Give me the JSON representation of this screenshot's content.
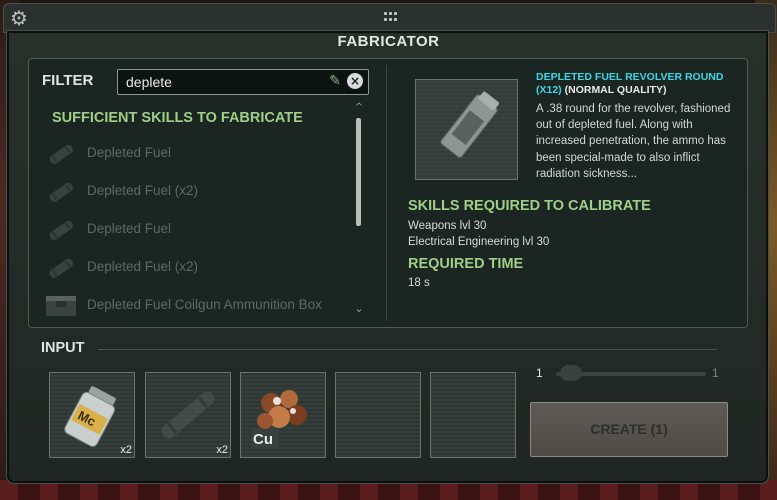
{
  "window": {
    "title": "FABRICATOR"
  },
  "filter": {
    "label": "FILTER",
    "value": "deplete"
  },
  "recipes": {
    "section_title": "SUFFICIENT SKILLS TO FABRICATE",
    "items": [
      {
        "label": "Depleted Fuel",
        "icon": "fuel-rod-icon"
      },
      {
        "label": "Depleted Fuel (x2)",
        "icon": "fuel-rod-icon"
      },
      {
        "label": "Depleted Fuel",
        "icon": "fuel-rod-icon"
      },
      {
        "label": "Depleted Fuel (x2)",
        "icon": "fuel-rod-icon"
      },
      {
        "label": "Depleted Fuel Coilgun Ammunition Box",
        "icon": "ammo-box-icon"
      }
    ]
  },
  "details": {
    "item_name": "DEPLETED FUEL REVOLVER ROUND (X12)",
    "quality": "(NORMAL QUALITY)",
    "description": "A .38 round for the revolver, fashioned out of depleted fuel. Along with increased penetration, the ammo has been special-made to also inflict radiation sickness...",
    "skills_title": "SKILLS REQUIRED TO CALIBRATE",
    "skills": [
      "Weapons lvl 30",
      "Electrical Engineering lvl 30"
    ],
    "time_title": "REQUIRED TIME",
    "time_value": "18 s"
  },
  "input": {
    "label": "INPUT",
    "slots": [
      {
        "icon": "chemical-jar-icon",
        "count": "x2",
        "label": "Mc"
      },
      {
        "icon": "fuel-rod-icon",
        "count": "x2"
      },
      {
        "icon": "copper-ore-icon",
        "count": "",
        "label": "Cu"
      },
      {
        "icon": "empty-slot",
        "count": ""
      },
      {
        "icon": "empty-slot",
        "count": ""
      }
    ]
  },
  "amount": {
    "min": "1",
    "max": "1",
    "value": 1
  },
  "create_button": {
    "label": "CREATE (1)"
  },
  "colors": {
    "accent_green": "#9fcf86",
    "item_cyan": "#3fd6e6"
  }
}
